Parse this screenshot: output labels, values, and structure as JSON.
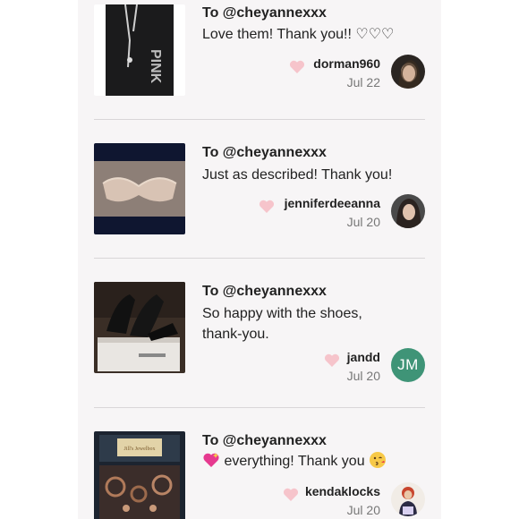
{
  "reviews": [
    {
      "to": "To @cheyannexxx",
      "message": "Love them! Thank you!! ♡♡♡",
      "username": "dorman960",
      "date": "Jul 22",
      "thumb_icon": "pants-thumbnail",
      "thumb_text": "PINK",
      "avatar_icon": "avatar-photo"
    },
    {
      "to": "To @cheyannexxx",
      "message": "Just as described! Thank you!",
      "username": "jenniferdeeanna",
      "date": "Jul 20",
      "thumb_icon": "bra-thumbnail",
      "avatar_icon": "avatar-photo"
    },
    {
      "to": "To @cheyannexxx",
      "message_line1": "So happy with the shoes,",
      "message_line2": "thank-you.",
      "username": "jandd",
      "date": "Jul 20",
      "thumb_icon": "shoes-thumbnail",
      "avatar_initials": "JM",
      "avatar_color": "#3f9477"
    },
    {
      "to": "To @cheyannexxx",
      "message": "everything! Thank you",
      "username": "kendaklocks",
      "date": "Jul 20",
      "thumb_icon": "jewelry-thumbnail",
      "thumb_text": "Jill's Jewelbox",
      "avatar_icon": "avatar-photo",
      "emoji_lead": "sparkling-heart-icon",
      "emoji_trail": "kiss-face-icon"
    }
  ],
  "colors": {
    "heart": "#f6c4cb",
    "panel_bg": "#f7f5f6",
    "divider": "#d9d6d8"
  }
}
